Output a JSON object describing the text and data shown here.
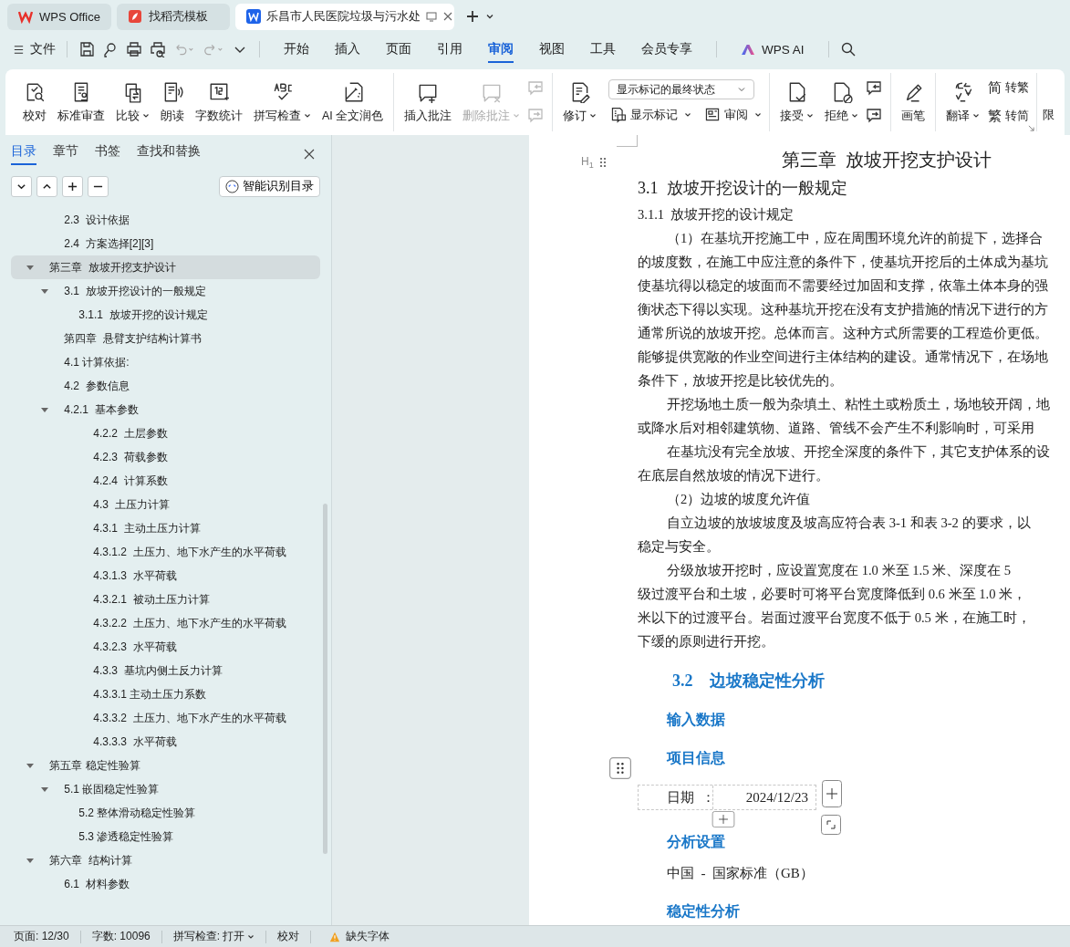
{
  "title_tabs": [
    {
      "label": "WPS Office",
      "kind": "home",
      "selected": false
    },
    {
      "label": "找稻壳模板",
      "kind": "template",
      "selected": false
    },
    {
      "label": "乐昌市人民医院垃圾与污水处",
      "kind": "document",
      "selected": true
    }
  ],
  "menu": {
    "file": "文件",
    "tabs": [
      {
        "label": "开始",
        "selected": false
      },
      {
        "label": "插入",
        "selected": false
      },
      {
        "label": "页面",
        "selected": false
      },
      {
        "label": "引用",
        "selected": false
      },
      {
        "label": "审阅",
        "selected": true
      },
      {
        "label": "视图",
        "selected": false
      },
      {
        "label": "工具",
        "selected": false
      },
      {
        "label": "会员专享",
        "selected": false
      }
    ],
    "ai": "WPS AI"
  },
  "ribbon": [
    {
      "items": [
        {
          "kind": "large",
          "label": "校对",
          "dropdown": false,
          "disabled": false
        },
        {
          "kind": "large",
          "label": "标准审查",
          "dropdown": false,
          "disabled": false
        },
        {
          "kind": "large",
          "label": "比较",
          "dropdown": true,
          "disabled": false
        },
        {
          "kind": "large",
          "label": "朗读",
          "dropdown": false,
          "disabled": false
        },
        {
          "kind": "large",
          "label": "字数统计",
          "dropdown": false,
          "disabled": false
        },
        {
          "kind": "large",
          "label": "拼写检查",
          "dropdown": true,
          "disabled": false
        },
        {
          "kind": "large",
          "label": "AI 全文润色",
          "dropdown": false,
          "disabled": false
        }
      ]
    },
    {
      "items": [
        {
          "kind": "large",
          "label": "插入批注",
          "dropdown": false,
          "disabled": false
        },
        {
          "kind": "large",
          "label": "删除批注",
          "dropdown": true,
          "disabled": true
        },
        {
          "kind": "stack",
          "entries": [
            {
              "disabled": true
            },
            {
              "disabled": true
            }
          ]
        }
      ]
    },
    {
      "items": [
        {
          "kind": "large",
          "label": "修订",
          "dropdown": true,
          "disabled": false
        },
        {
          "kind": "panel",
          "select": "显示标记的最终状态",
          "buttons": [
            {
              "label": "显示标记"
            },
            {
              "label": "审阅"
            }
          ]
        }
      ]
    },
    {
      "items": [
        {
          "kind": "large",
          "label": "接受",
          "dropdown": true,
          "disabled": false
        },
        {
          "kind": "large",
          "label": "拒绝",
          "dropdown": true,
          "disabled": false
        },
        {
          "kind": "stack",
          "entries": [
            {
              "disabled": false
            },
            {
              "disabled": false
            }
          ]
        }
      ]
    },
    {
      "items": [
        {
          "kind": "large",
          "label": "画笔",
          "dropdown": false,
          "disabled": false
        }
      ]
    },
    {
      "items": [
        {
          "kind": "large",
          "label": "翻译",
          "dropdown": true,
          "disabled": false
        },
        {
          "kind": "labels",
          "entries": [
            {
              "glyph": "简",
              "label": "转繁"
            },
            {
              "glyph": "繁",
              "label": "转简"
            }
          ]
        }
      ]
    },
    {
      "items": [
        {
          "kind": "cut",
          "label": "限"
        }
      ]
    }
  ],
  "nav": {
    "tabs": [
      {
        "label": "目录",
        "selected": true
      },
      {
        "label": "章节",
        "selected": false
      },
      {
        "label": "书签",
        "selected": false
      },
      {
        "label": "查找和替换",
        "selected": false
      }
    ],
    "smart_button": "智能识别目录",
    "toc": [
      {
        "label": "2.3  设计依据",
        "kind": "indented",
        "selected": false
      },
      {
        "label": "2.4  方案选择[2][3]",
        "kind": "indented",
        "selected": false
      },
      {
        "label": "第三章  放坡开挖支护设计",
        "kind": "flush",
        "selected": true,
        "expanded": true,
        "children": [
          {
            "label": "3.1  放坡开挖设计的一般规定",
            "kind": "flush",
            "selected": false,
            "expanded": true,
            "children": [
              {
                "label": "3.1.1  放坡开挖的设计规定",
                "kind": "flush",
                "selected": false
              }
            ]
          }
        ]
      },
      {
        "label": "第四章  悬臂支护结构计算书",
        "kind": "indented",
        "selected": false
      },
      {
        "label": "4.1 计算依据:",
        "kind": "indented",
        "selected": false
      },
      {
        "label": "4.2  参数信息",
        "kind": "indented",
        "selected": false
      },
      {
        "label": "4.2.1  基本参数",
        "kind": "indented",
        "selected": false,
        "expanded": true,
        "children": [
          {
            "label": "4.2.2  土层参数",
            "kind": "deep",
            "selected": false
          },
          {
            "label": "4.2.3  荷载参数",
            "kind": "deep",
            "selected": false
          },
          {
            "label": "4.2.4  计算系数",
            "kind": "deep",
            "selected": false
          },
          {
            "label": "4.3  土压力计算",
            "kind": "deep",
            "selected": false
          },
          {
            "label": "4.3.1  主动土压力计算",
            "kind": "deep",
            "selected": false
          },
          {
            "label": "4.3.1.2  土压力、地下水产生的水平荷载",
            "kind": "deep",
            "selected": false
          },
          {
            "label": "4.3.1.3  水平荷载",
            "kind": "deep",
            "selected": false
          },
          {
            "label": "4.3.2.1  被动土压力计算",
            "kind": "deep",
            "selected": false
          },
          {
            "label": "4.3.2.2  土压力、地下水产生的水平荷载",
            "kind": "deep",
            "selected": false
          },
          {
            "label": "4.3.2.3  水平荷载",
            "kind": "deep",
            "selected": false
          },
          {
            "label": "4.3.3  基坑内侧土反力计算",
            "kind": "deep",
            "selected": false
          },
          {
            "label": "4.3.3.1 主动土压力系数",
            "kind": "deep",
            "selected": false
          },
          {
            "label": "4.3.3.2  土压力、地下水产生的水平荷载",
            "kind": "deep",
            "selected": false
          },
          {
            "label": "4.3.3.3  水平荷载",
            "kind": "deep",
            "selected": false
          }
        ]
      },
      {
        "label": "第五章 稳定性验算",
        "kind": "flush",
        "selected": false,
        "expanded": true,
        "children": [
          {
            "label": "5.1 嵌固稳定性验算",
            "kind": "flush",
            "selected": false,
            "expanded": true,
            "children": [
              {
                "label": "5.2 整体滑动稳定性验算",
                "kind": "flush",
                "selected": false
              },
              {
                "label": "5.3 渗透稳定性验算",
                "kind": "flush",
                "selected": false
              }
            ]
          }
        ]
      },
      {
        "label": "第六章  结构计算",
        "kind": "flush",
        "selected": false,
        "expanded": true,
        "children": [
          {
            "label": "6.1  材料参数",
            "kind": "flush",
            "selected": false
          }
        ]
      }
    ]
  },
  "document": {
    "heading_marker": "H$_{1}$",
    "chapter_title": "第三章  放坡开挖支护设计",
    "section_title": "3.1  放坡开挖设计的一般规定",
    "subsection_title": "3.1.1  放坡开挖的设计规定",
    "lines": [
      {
        "text": "（1）在基坑开挖施工中，应在周围环境允许的前提下，选择合",
        "indent": true
      },
      {
        "text": "的坡度数，在施工中应注意的条件下，使基坑开挖后的土体成为基坑",
        "indent": false
      },
      {
        "text": "使基坑得以稳定的坡面而不需要经过加固和支撑，依靠土体本身的强",
        "indent": false
      },
      {
        "text": "衡状态下得以实现。这种基坑开挖在没有支护措施的情况下进行的方",
        "indent": false
      },
      {
        "text": "通常所说的放坡开挖。总体而言。这种方式所需要的工程造价更低。",
        "indent": false
      },
      {
        "text": "能够提供宽敞的作业空间进行主体结构的建设。通常情况下，在场地",
        "indent": false
      },
      {
        "text": "条件下，放坡开挖是比较优先的。",
        "indent": false
      },
      {
        "text": "开挖场地土质一般为杂填土、粘性土或粉质土，场地较开阔，地",
        "indent": true
      },
      {
        "text": "或降水后对相邻建筑物、道路、管线不会产生不利影响时，可采用",
        "indent": false
      },
      {
        "text": "在基坑没有完全放坡、开挖全深度的条件下，其它支护体系的设",
        "indent": true
      },
      {
        "text": "在底层自然放坡的情况下进行。",
        "indent": false
      },
      {
        "text": "（2）边坡的坡度允许值",
        "indent": true
      },
      {
        "text": "自立边坡的放坡坡度及坡高应符合表 3-1 和表 3-2 的要求，以",
        "indent": true
      },
      {
        "text": "稳定与安全。",
        "indent": false
      },
      {
        "text": "分级放坡开挖时，应设置宽度在 1.0 米至 1.5 米、深度在 5",
        "indent": true
      },
      {
        "text": "级过渡平台和土坡，必要时可将平台宽度降低到 0.6 米至 1.0 米，",
        "indent": false
      },
      {
        "text": "米以下的过渡平台。岩面过渡平台宽度不低于 0.5 米，在施工时，",
        "indent": false
      },
      {
        "text": "下缓的原则进行开挖。",
        "indent": false
      }
    ],
    "blue_heading": "3.2    边坡稳定性分析",
    "input_heading": "输入数据",
    "project_heading": "项目信息",
    "table": {
      "label": "日期  ：",
      "value": "2024/12/23"
    },
    "settings_heading": "分析设置",
    "standard": "中国  -  国家标准（GB）",
    "stability_heading": "稳定性分析"
  },
  "status_bar": {
    "page": "页面: 12/30",
    "words": "字数: 10096",
    "spell": "拼写检查: 打开",
    "proof": "校对",
    "font_warning": "缺失字体"
  }
}
